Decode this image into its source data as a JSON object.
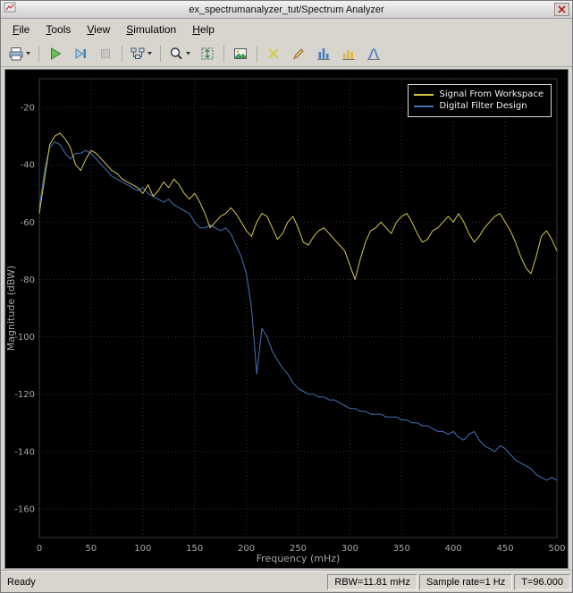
{
  "window": {
    "title": "ex_spectrumanalyzer_tut/Spectrum Analyzer"
  },
  "menubar": {
    "items": [
      {
        "label": "File"
      },
      {
        "label": "Tools"
      },
      {
        "label": "View"
      },
      {
        "label": "Simulation"
      },
      {
        "label": "Help"
      }
    ]
  },
  "toolbar": {
    "icons": [
      "print-icon",
      "run-icon",
      "step-forward-icon",
      "stop-icon",
      "simulation-settings-icon",
      "zoom-icon",
      "fit-to-view-icon",
      "snapshot-icon",
      "cursor-measurements-icon",
      "signal-statistics-icon",
      "peak-finder-icon",
      "distortion-measurements-icon",
      "ccdf-measurements-icon"
    ]
  },
  "statusbar": {
    "ready": "Ready",
    "rbw": "RBW=11.81 mHz",
    "sample_rate": "Sample rate=1 Hz",
    "time": "T=96.000"
  },
  "chart_data": {
    "type": "line",
    "title": "",
    "xlabel": "Frequency (mHz)",
    "ylabel": "Magnitude (dBW)",
    "xlim": [
      0,
      500
    ],
    "ylim": [
      -170,
      -10
    ],
    "xticks": [
      0,
      50,
      100,
      150,
      200,
      250,
      300,
      350,
      400,
      450,
      500
    ],
    "yticks": [
      -20,
      -40,
      -60,
      -80,
      -100,
      -120,
      -140,
      -160
    ],
    "grid": true,
    "legend_position": "top-right",
    "colors": {
      "background": "#000000",
      "grid": "#2e2e2e",
      "frame": "#3c3c3c",
      "ticks": "#a6a6a6"
    },
    "x": [
      0,
      5,
      10,
      15,
      20,
      25,
      30,
      35,
      40,
      45,
      50,
      55,
      60,
      65,
      70,
      75,
      80,
      85,
      90,
      95,
      100,
      105,
      110,
      115,
      120,
      125,
      130,
      135,
      140,
      145,
      150,
      155,
      160,
      165,
      170,
      175,
      180,
      185,
      190,
      195,
      200,
      205,
      210,
      215,
      220,
      225,
      230,
      235,
      240,
      245,
      250,
      255,
      260,
      265,
      270,
      275,
      280,
      285,
      290,
      295,
      300,
      305,
      310,
      315,
      320,
      325,
      330,
      335,
      340,
      345,
      350,
      355,
      360,
      365,
      370,
      375,
      380,
      385,
      390,
      395,
      400,
      405,
      410,
      415,
      420,
      425,
      430,
      435,
      440,
      445,
      450,
      455,
      460,
      465,
      470,
      475,
      480,
      485,
      490,
      495,
      500
    ],
    "series": [
      {
        "name": "Signal From Workspace",
        "color": "#d6c94e",
        "values": [
          -57,
          -45,
          -33,
          -30,
          -29,
          -31,
          -34,
          -40,
          -42,
          -38,
          -35,
          -36,
          -38,
          -40,
          -42,
          -43,
          -45,
          -46,
          -47,
          -48,
          -50,
          -47,
          -51,
          -49,
          -46,
          -48,
          -45,
          -47,
          -50,
          -52,
          -50,
          -53,
          -57,
          -62,
          -60,
          -58,
          -57,
          -55,
          -57,
          -60,
          -63,
          -65,
          -60,
          -57,
          -58,
          -62,
          -66,
          -64,
          -60,
          -58,
          -62,
          -67,
          -68,
          -65,
          -63,
          -62,
          -64,
          -66,
          -68,
          -70,
          -75,
          -80,
          -73,
          -67,
          -63,
          -62,
          -60,
          -62,
          -64,
          -60,
          -58,
          -57,
          -60,
          -64,
          -67,
          -66,
          -63,
          -62,
          -60,
          -58,
          -60,
          -57,
          -60,
          -64,
          -67,
          -65,
          -62,
          -60,
          -58,
          -57,
          -60,
          -63,
          -67,
          -72,
          -76,
          -78,
          -72,
          -65,
          -63,
          -66,
          -70
        ]
      },
      {
        "name": "Digital Filter Design",
        "color": "#4273b8",
        "values": [
          -55,
          -42,
          -34,
          -32,
          -33,
          -36,
          -38,
          -36,
          -36,
          -35,
          -36,
          -38,
          -40,
          -42,
          -44,
          -45,
          -46,
          -47,
          -48,
          -49,
          -48,
          -50,
          -51,
          -52,
          -53,
          -52,
          -54,
          -55,
          -56,
          -57,
          -60,
          -62,
          -62,
          -61,
          -62,
          -63,
          -62,
          -64,
          -68,
          -72,
          -78,
          -90,
          -113,
          -97,
          -100,
          -105,
          -108,
          -111,
          -113,
          -116,
          -118,
          -119,
          -120,
          -120,
          -121,
          -121,
          -122,
          -122,
          -123,
          -124,
          -125,
          -125,
          -126,
          -126,
          -127,
          -127,
          -127,
          -128,
          -128,
          -128,
          -129,
          -129,
          -130,
          -130,
          -131,
          -131,
          -132,
          -133,
          -133,
          -134,
          -133,
          -135,
          -136,
          -134,
          -133,
          -136,
          -138,
          -139,
          -140,
          -138,
          -139,
          -141,
          -143,
          -144,
          -145,
          -146,
          -148,
          -149,
          -150,
          -149,
          -150
        ]
      }
    ]
  }
}
